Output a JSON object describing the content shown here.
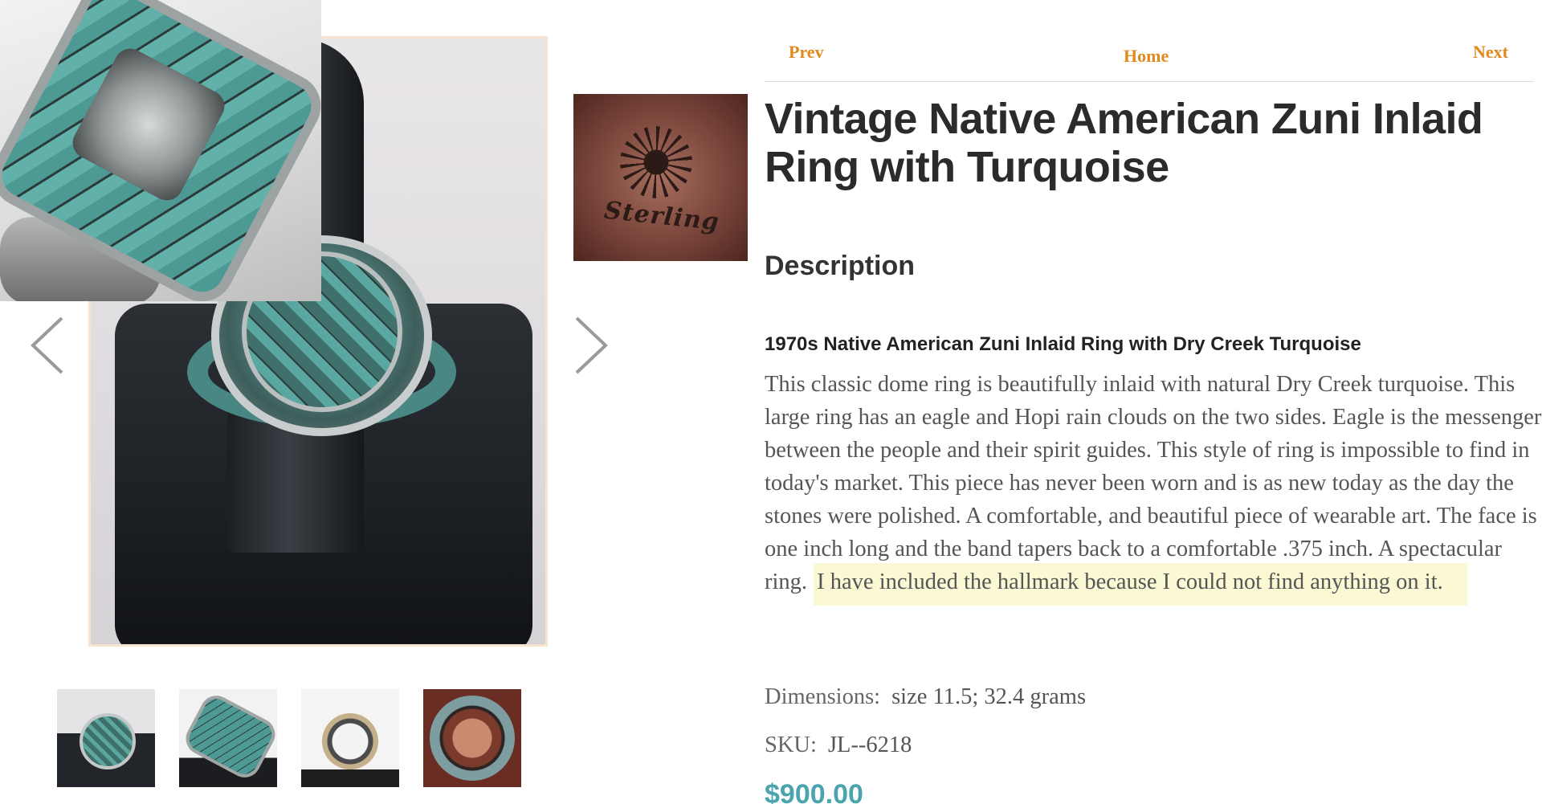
{
  "nav": {
    "prev_label": "Prev",
    "home_label": "Home",
    "next_label": "Next"
  },
  "product": {
    "title": "Vintage Native American Zuni Inlaid Ring with Turquoise",
    "section_heading": "Description",
    "subheading": "1970s Native American Zuni Inlaid Ring with Dry Creek Turquoise",
    "description": "This classic dome ring is beautifully inlaid with natural Dry Creek turquoise. This large ring has an eagle and Hopi rain clouds on the two sides. Eagle is the messenger between the people and their spirit guides. This style of ring is impossible to find in today's market. This piece has never been worn and is as new today as the day the stones were polished. A comfortable, and beautiful piece of wearable art. The face is one inch long and the band tapers back to a comfortable .375 inch. A spectacular ring.",
    "description_highlight": "I have included the hallmark because I could not find anything on it.",
    "dimensions_label": "Dimensions:",
    "dimensions_value": "size 11.5; 32.4 grams",
    "sku_label": "SKU:",
    "sku_value": "JL--6218",
    "price": "$900.00"
  },
  "gallery": {
    "hallmark_text": "Sterling",
    "arrow_prev_icon": "chevron-left-icon",
    "arrow_next_icon": "chevron-right-icon",
    "thumbnail_count": 4
  },
  "colors": {
    "accent_orange": "#e08a1e",
    "price_teal": "#4aa3ad",
    "highlight_yellow": "#fbf8d4",
    "title_dark": "#2b2b2b"
  }
}
